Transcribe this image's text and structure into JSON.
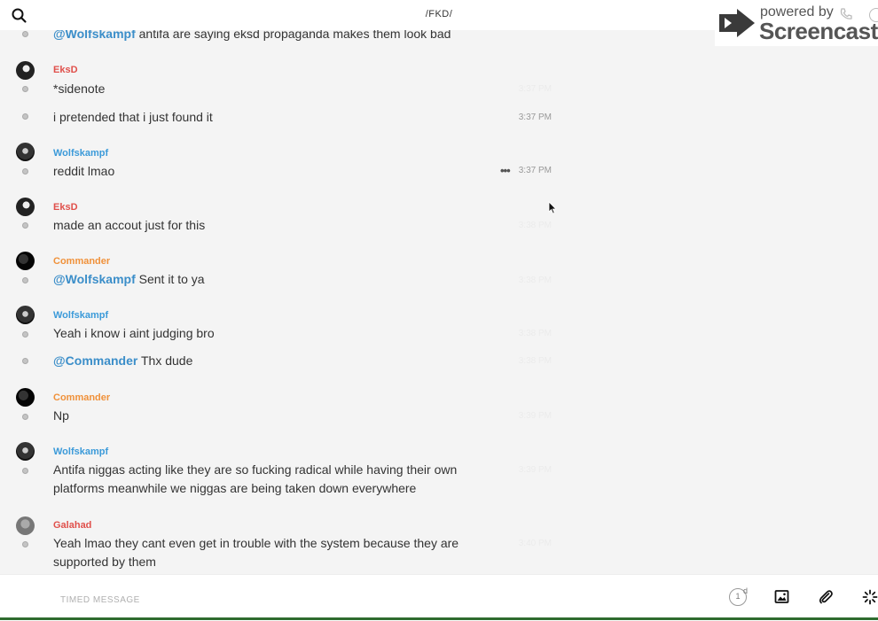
{
  "header": {
    "title": "/FKD/",
    "search_icon": "search-icon"
  },
  "watermark": {
    "powered": "powered by",
    "name": "Screencastify"
  },
  "colors": {
    "eksd": "#e0504b",
    "wolfskampf": "#3b9ad9",
    "commander": "#f0913a",
    "galahad": "#e0504b",
    "mention": "#3b8ec9"
  },
  "messages": [
    {
      "sender": "",
      "mention": "@Wolfskampf",
      "text": " antifa are saying eksd propaganda makes them look bad",
      "time": ""
    },
    {
      "sender": "EksD",
      "mention": "",
      "text": "*sidenote",
      "time": "3:37 PM"
    },
    {
      "sender": "",
      "mention": "",
      "text": "i pretended that i just found it",
      "time": "3:37 PM"
    },
    {
      "sender": "Wolfskampf",
      "mention": "",
      "text": "reddit lmao",
      "time": "3:37 PM",
      "more": "•••"
    },
    {
      "sender": "EksD",
      "mention": "",
      "text": "made an accout just for this",
      "time": "3:38 PM"
    },
    {
      "sender": "Commander",
      "mention": "@Wolfskampf",
      "text": " Sent it to ya",
      "time": "3:38 PM"
    },
    {
      "sender": "Wolfskampf",
      "mention": "",
      "text": "Yeah i know i aint judging bro",
      "time": "3:38 PM"
    },
    {
      "sender": "",
      "mention": "@Commander",
      "text": " Thx dude",
      "time": "3:38 PM"
    },
    {
      "sender": "Commander",
      "mention": "",
      "text": "Np",
      "time": "3:39 PM"
    },
    {
      "sender": "Wolfskampf",
      "mention": "",
      "text": "Antifa niggas acting like they are so fucking radical while having their own platforms meanwhile we niggas are being taken down everywhere",
      "time": "3:39 PM"
    },
    {
      "sender": "Galahad",
      "mention": "",
      "text": "Yeah lmao they cant even get in trouble with the system because they are supported by them",
      "time": "3:40 PM"
    }
  ],
  "composer": {
    "placeholder": "TIMED MESSAGE",
    "timer_value": "1",
    "timer_unit": "d"
  }
}
